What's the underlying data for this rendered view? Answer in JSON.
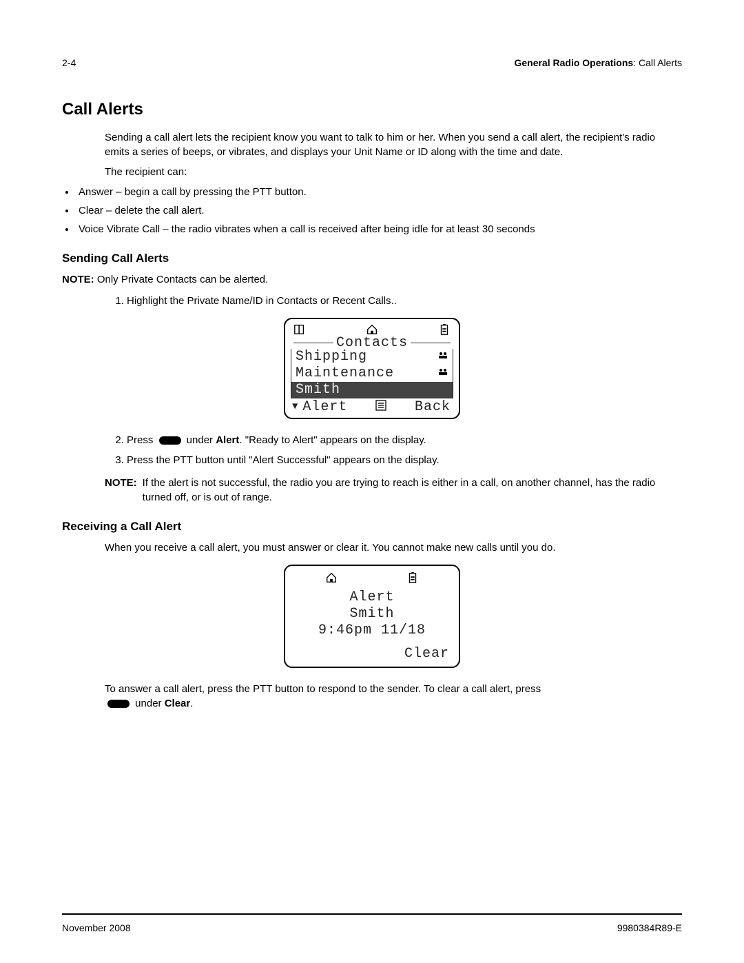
{
  "header": {
    "page_number": "2-4",
    "chapter_bold": "General Radio Operations",
    "chapter_rest": ": Call Alerts"
  },
  "h1": "Call Alerts",
  "intro": "Sending a call alert lets the recipient know you want to talk to him or her. When you send a call alert, the recipient's radio emits a series of beeps, or vibrates, and displays your Unit Name or ID along with the time and date.",
  "recipient_can_label": "The recipient can:",
  "bullets": {
    "b1": "Answer – begin a call by pressing the PTT button.",
    "b2": "Clear – delete the call alert.",
    "b3": "Voice Vibrate Call – the radio vibrates when a call is received after being idle for at least 30 seconds"
  },
  "sending": {
    "heading": "Sending Call Alerts",
    "note_label": "NOTE:",
    "note_text": " Only Private Contacts can be alerted.",
    "step1": "Highlight the Private Name/ID in Contacts or Recent Calls..",
    "step2_pre": "Press ",
    "step2_mid": " under ",
    "step2_bold": "Alert",
    "step2_post": ". \"Ready to Alert\" appears on the display.",
    "step3": "Press the PTT button until \"Alert Successful\" appears on the display.",
    "note2_label": "NOTE:",
    "note2_text": "If the alert is not successful, the radio you are trying to reach is either in a call, on another channel, has the radio turned off, or is out of range."
  },
  "lcd1": {
    "title": "Contacts",
    "item1": "Shipping",
    "item2": "Maintenance",
    "item3": "Smith",
    "soft_left": "Alert",
    "soft_right": "Back"
  },
  "receiving": {
    "heading": "Receiving a Call Alert",
    "intro": "When you receive a call alert, you must answer or clear it. You cannot make new calls until you do.",
    "lcd": {
      "line1": "Alert",
      "line2": "Smith",
      "line3": "9:46pm 11/18",
      "soft_right": "Clear"
    },
    "answer_pre": "To answer a call alert, press the PTT button to respond to the sender. To clear a call alert, press ",
    "answer_mid": " under ",
    "answer_bold": "Clear",
    "answer_post": "."
  },
  "footer": {
    "left": "November 2008",
    "right": "9980384R89-E"
  }
}
